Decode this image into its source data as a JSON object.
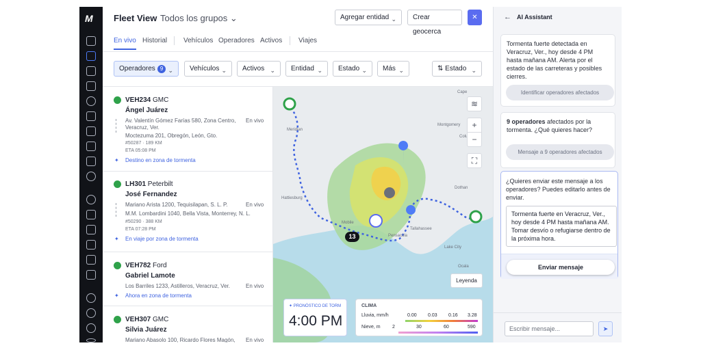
{
  "app": {
    "logo": "M"
  },
  "header": {
    "title": "Fleet View",
    "group": "Todos los grupos",
    "add_entity": "Agregar entidad",
    "create_geofence": "Crear geocerca",
    "close": "✕"
  },
  "tabs": [
    {
      "label": "En vivo"
    },
    {
      "label": "Historial"
    },
    {
      "label": "Vehículos"
    },
    {
      "label": "Operadores"
    },
    {
      "label": "Activos"
    },
    {
      "label": "Viajes"
    }
  ],
  "filters": {
    "operators": "Operadores",
    "operators_count": "9",
    "vehicles": "Vehículos",
    "assets": "Activos",
    "entity": "Entidad",
    "status": "Estado",
    "more": "Más",
    "sort": "Estado"
  },
  "vehicles": [
    {
      "id": "VEH234",
      "make": "GMC",
      "driver": "Ángel Juárez",
      "addr1": "Av. Valentín Gómez Farías 580, Zona Centro,",
      "addr1b": "Veracruz, Ver.",
      "addr2": "Moctezuma 201, Obregón, León, Gto.",
      "status": "En vivo",
      "meta": "#50287 · 189 KM",
      "eta": "ETA 05:08 PM",
      "alert": "Destino en zona de tormenta"
    },
    {
      "id": "LH301",
      "make": "Peterbilt",
      "driver": "José Fernandez",
      "addr1": "Mariano Arista 1200, Tequisilapan, S. L. P.",
      "addr2": "M.M. Lombardini 1040, Bella Vista, Monterrey, N. L.",
      "status": "En vivo",
      "meta": "#50290 · 388 KM",
      "eta": "ETA 07:28 PM",
      "alert": "En viaje por zona de tormenta"
    },
    {
      "id": "VEH782",
      "make": "Ford",
      "driver": "Gabriel Lamote",
      "addr1": "Los Barriles 1233, Astilleros, Veracruz, Ver.",
      "status": "En vivo",
      "alert": "Ahora en zona de tormenta"
    },
    {
      "id": "VEH307",
      "make": "GMC",
      "driver": "Silvia Juárez",
      "addr1": "Mariano Abasolo 100, Ricardo Flores Magón,",
      "status": "En vivo"
    }
  ],
  "map": {
    "legend": "Leyenda",
    "cluster": "13",
    "forecast_label": "PRONÓSTICO DE TORM",
    "forecast_time": "4:00 PM",
    "clima_title": "CLIMA",
    "rain_label": "Lluvia, mm/h",
    "rain_ticks": [
      "0.00",
      "0.03",
      "0.16",
      "3.28"
    ],
    "snow_label": "Nieve, m",
    "snow_ticks": [
      "2",
      "30",
      "60",
      "590"
    ],
    "places": [
      "Cape",
      "Montgomery",
      "Columbus",
      "Meridian",
      "Dothan",
      "Hattiesburg",
      "Pensacola",
      "Mobile",
      "Tallahassee",
      "Lake City",
      "Ocala"
    ]
  },
  "assistant": {
    "title": "AI Assistant",
    "msg1": "Tormenta fuerte detectada en Veracruz, Ver., hoy desde 4 PM hasta mañana AM. Alerta por el estado de las carreteras y posibles cierres.",
    "btn1": "Identificar operadores afectados",
    "msg2_bold": "9 operadores",
    "msg2": " afectados por la tormenta. ¿Qué quieres hacer?",
    "btn2": "Mensaje a 9 operadores afectados",
    "question": "¿Quieres enviar este mensaje a los operadores? Puedes editarlo antes de enviar.",
    "draft": "Tormenta fuerte en Veracruz, Ver., hoy desde 4 PM hasta mañana AM. Tomar desvío o refugiarse dentro de la próxima hora.",
    "send": "Enviar mensaje",
    "placeholder": "Escribir mensaje..."
  }
}
